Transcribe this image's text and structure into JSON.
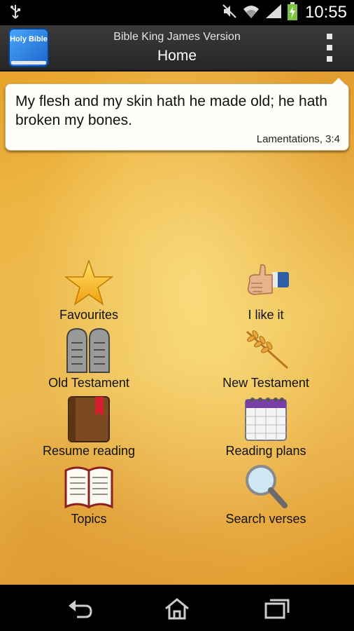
{
  "status_bar": {
    "time": "10:55",
    "icons": [
      "usb-icon",
      "mute-icon",
      "wifi-icon",
      "signal-icon",
      "battery-charging-icon"
    ]
  },
  "action_bar": {
    "app_icon_text": "Holy Bible",
    "app_name": "Bible King James Version",
    "title": "Home",
    "overflow_icon": "overflow-menu-icon"
  },
  "verse": {
    "text": "My flesh and my skin hath he made old; he hath broken my bones.",
    "reference": "Lamentations, 3:4"
  },
  "menu": [
    {
      "label": "Favourites",
      "icon": "star-icon"
    },
    {
      "label": "I like it",
      "icon": "thumbs-up-icon"
    },
    {
      "label": "Old Testament",
      "icon": "stone-tablets-icon"
    },
    {
      "label": "New Testament",
      "icon": "wheat-icon"
    },
    {
      "label": "Resume reading",
      "icon": "bookmarked-book-icon"
    },
    {
      "label": "Reading plans",
      "icon": "calendar-icon"
    },
    {
      "label": "Topics",
      "icon": "open-book-icon"
    },
    {
      "label": "Search verses",
      "icon": "magnifier-icon"
    }
  ],
  "nav_bar": {
    "icons": [
      "back-icon",
      "home-icon",
      "recent-apps-icon"
    ]
  },
  "colors": {
    "parchment": "#f0c052",
    "action_bar": "#2e2e2e",
    "app_icon": "#2f86e8"
  }
}
